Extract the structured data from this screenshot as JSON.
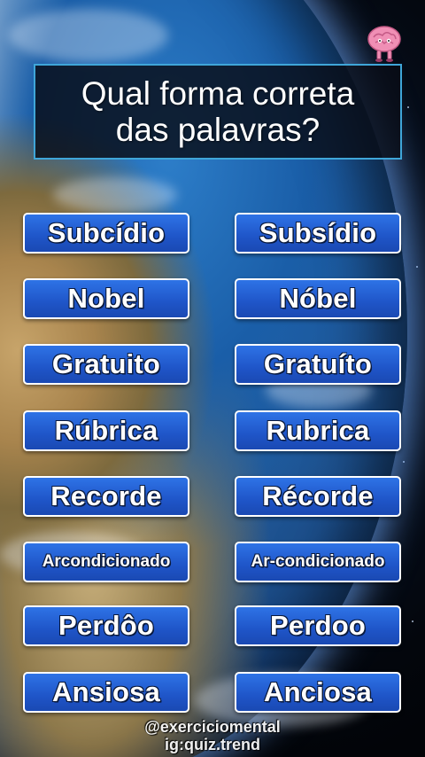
{
  "title": {
    "line1": "Qual forma correta",
    "line2": "das palavras?"
  },
  "options": [
    {
      "left": "Subcídio",
      "right": "Subsídio"
    },
    {
      "left": "Nobel",
      "right": "Nóbel"
    },
    {
      "left": "Gratuito",
      "right": "Gratuíto"
    },
    {
      "left": "Rúbrica",
      "right": "Rubrica"
    },
    {
      "left": "Recorde",
      "right": "Récorde"
    },
    {
      "left": "Arcondicionado",
      "right": "Ar-condicionado"
    },
    {
      "left": "Perdôo",
      "right": "Perdoo"
    },
    {
      "left": "Ansiosa",
      "right": "Anciosa"
    }
  ],
  "watermark": {
    "line1": "@exerciciomental",
    "line2": "ig:quiz.trend"
  },
  "colors": {
    "button_fill": "#2563d9",
    "button_border": "#ffffff",
    "title_border": "#3fa6d9",
    "brain": "#f08fb5"
  },
  "icons": {
    "brand": "brain-icon"
  }
}
